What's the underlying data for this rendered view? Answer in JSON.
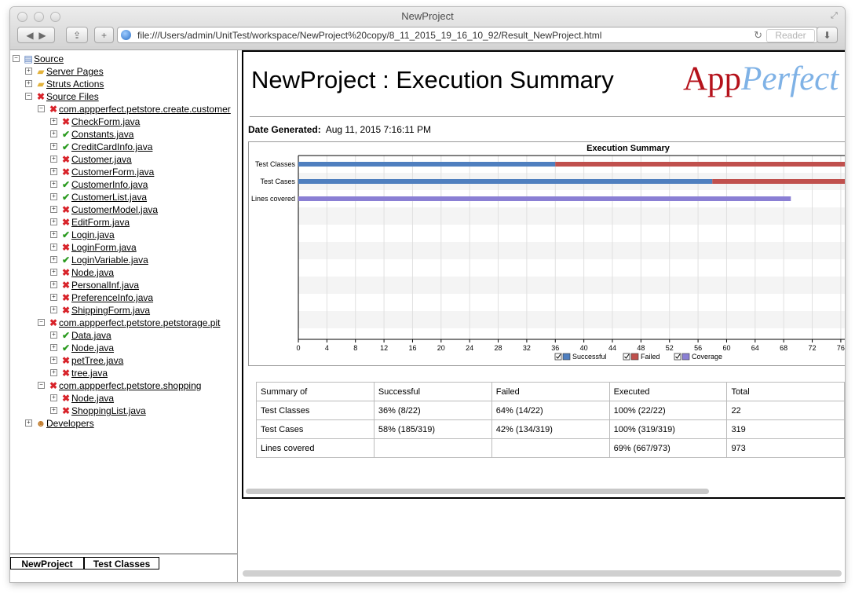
{
  "window": {
    "title": "NewProject",
    "url": "file:///Users/admin/UnitTest/workspace/NewProject%20copy/8_11_2015_19_16_10_92/Result_NewProject.html",
    "reader_label": "Reader"
  },
  "tree": {
    "root": "Source",
    "server_pages": "Server Pages",
    "struts_actions": "Struts Actions",
    "source_files": "Source Files",
    "pkg1": "com.appperfect.petstore.create.customer",
    "pkg1_files": [
      {
        "name": "CheckForm.java",
        "status": "failed"
      },
      {
        "name": "Constants.java",
        "status": "passed"
      },
      {
        "name": "CreditCardInfo.java",
        "status": "passed"
      },
      {
        "name": "Customer.java",
        "status": "failed"
      },
      {
        "name": "CustomerForm.java",
        "status": "failed"
      },
      {
        "name": "CustomerInfo.java",
        "status": "passed"
      },
      {
        "name": "CustomerList.java",
        "status": "passed"
      },
      {
        "name": "CustomerModel.java",
        "status": "failed"
      },
      {
        "name": "EditForm.java",
        "status": "failed"
      },
      {
        "name": "Login.java",
        "status": "passed"
      },
      {
        "name": "LoginForm.java",
        "status": "failed"
      },
      {
        "name": "LoginVariable.java",
        "status": "passed"
      },
      {
        "name": "Node.java",
        "status": "failed"
      },
      {
        "name": "PersonalInf.java",
        "status": "failed"
      },
      {
        "name": "PreferenceInfo.java",
        "status": "failed"
      },
      {
        "name": "ShippingForm.java",
        "status": "failed"
      }
    ],
    "pkg2": "com.appperfect.petstore.petstorage.pit",
    "pkg2_files": [
      {
        "name": "Data.java",
        "status": "passed"
      },
      {
        "name": "Node.java",
        "status": "passed"
      },
      {
        "name": "petTree.java",
        "status": "failed"
      },
      {
        "name": "tree.java",
        "status": "failed"
      }
    ],
    "pkg3": "com.appperfect.petstore.shopping",
    "pkg3_files": [
      {
        "name": "Node.java",
        "status": "failed"
      },
      {
        "name": "ShoppingList.java",
        "status": "failed"
      }
    ],
    "developers": "Developers"
  },
  "bottom_tabs": {
    "tab1": "NewProject",
    "tab2": "Test Classes"
  },
  "report": {
    "title": "NewProject : Execution Summary",
    "logo_app": "App",
    "logo_perfect": "Perfect",
    "date_label": "Date Generated:",
    "date_value": "Aug 11, 2015 7:16:11 PM"
  },
  "chart_data": {
    "type": "bar",
    "orientation": "horizontal",
    "stacked": true,
    "title": "Execution Summary",
    "categories": [
      "Test Classes",
      "Test Cases",
      "Lines covered"
    ],
    "x_ticks": [
      0,
      4,
      8,
      12,
      16,
      20,
      24,
      28,
      32,
      36,
      40,
      44,
      48,
      52,
      56,
      60,
      64,
      68,
      72,
      76
    ],
    "xlim": [
      0,
      77
    ],
    "series": [
      {
        "name": "Successful",
        "color": "#4f7fbf",
        "values": [
          36,
          58,
          0
        ]
      },
      {
        "name": "Failed",
        "color": "#c0504d",
        "values": [
          64,
          42,
          0
        ]
      },
      {
        "name": "Coverage",
        "color": "#8a7fd4",
        "values": [
          0,
          0,
          69
        ]
      }
    ],
    "legend": "bottom",
    "grid": true
  },
  "summary_table": {
    "headers": [
      "Summary of",
      "Successful",
      "Failed",
      "Executed",
      "Total"
    ],
    "rows": [
      [
        "Test Classes",
        "36% (8/22)",
        "64% (14/22)",
        "100% (22/22)",
        "22"
      ],
      [
        "Test Cases",
        "58% (185/319)",
        "42% (134/319)",
        "100% (319/319)",
        "319"
      ],
      [
        "Lines covered",
        "",
        "",
        "69% (667/973)",
        "973"
      ]
    ]
  }
}
